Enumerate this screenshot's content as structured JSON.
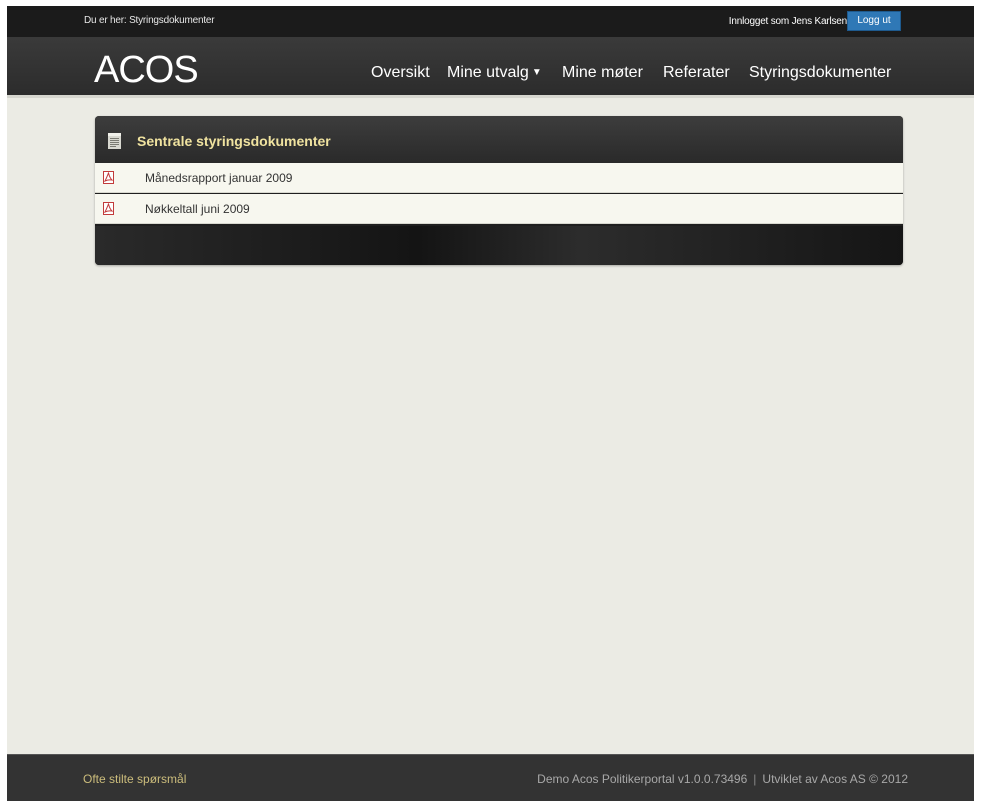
{
  "breadcrumb": {
    "prefix": "Du er her:",
    "current": "Styringsdokumenter"
  },
  "user": {
    "logged_in_text": "Innlogget som Jens Karlsen",
    "logout_label": "Logg ut"
  },
  "brand": {
    "logo": "ACOS"
  },
  "nav": {
    "items": [
      {
        "label": "Oversikt"
      },
      {
        "label": "Mine utvalg",
        "dropdown_icon": "caret-down-icon"
      },
      {
        "label": "Mine møter"
      },
      {
        "label": "Referater"
      },
      {
        "label": "Styringsdokumenter"
      }
    ]
  },
  "panel": {
    "title": "Sentrale styringsdokumenter",
    "icon": "document-icon",
    "documents": [
      {
        "label": "Månedsrapport januar 2009",
        "icon": "pdf-icon"
      },
      {
        "label": "Nøkkeltall juni 2009",
        "icon": "pdf-icon"
      }
    ]
  },
  "footer": {
    "faq_link": "Ofte stilte spørsmål",
    "version": "Demo Acos Politikerportal v1.0.0.73496",
    "separator": "|",
    "credit": "Utviklet av Acos AS © 2012"
  },
  "colors": {
    "accent_title": "#f0e3a0",
    "logout_button": "#2f78b6",
    "faq_link": "#ccbd7c",
    "page_background": "#ebebe4"
  }
}
